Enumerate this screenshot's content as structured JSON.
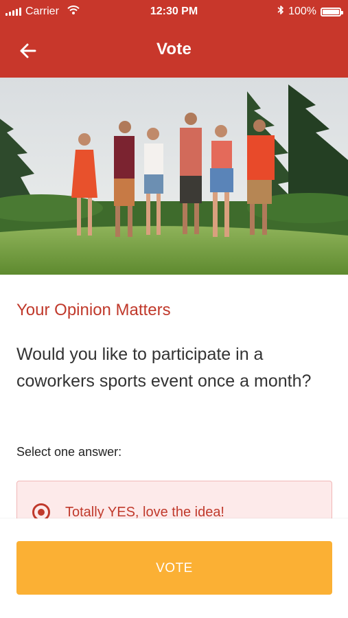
{
  "status_bar": {
    "carrier": "Carrier",
    "time": "12:30 PM",
    "battery": "100%"
  },
  "header": {
    "title": "Vote",
    "back_icon": "arrow-left-icon"
  },
  "colors": {
    "header_bg": "#c8372b",
    "accent_red": "#c0392b",
    "vote_button": "#fbb034",
    "answer_bg": "#fdeaea"
  },
  "poll": {
    "section_title": "Your Opinion Matters",
    "question": "Would you like to participate in a coworkers sports event once a month?",
    "hint": "Select one answer:",
    "answers": [
      {
        "label": "Totally YES, love the idea!",
        "selected": true
      }
    ]
  },
  "footer": {
    "vote_label": "VOTE"
  }
}
